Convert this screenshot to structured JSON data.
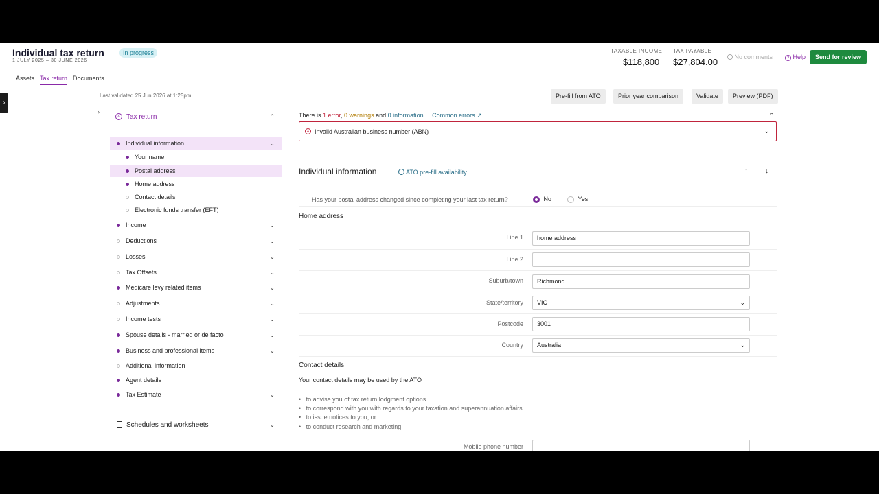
{
  "header": {
    "title": "Individual tax return",
    "status_badge": "In progress",
    "date_range": "1 JULY 2025 – 30 JUNE 2026",
    "taxable_income_label": "TAXABLE INCOME",
    "taxable_income_value": "$118,800",
    "tax_payable_label": "TAX PAYABLE",
    "tax_payable_value": "$27,804.00",
    "comments": "No comments",
    "help": "Help",
    "send_button": "Send for review"
  },
  "tabs": [
    "Assets",
    "Tax return",
    "Documents"
  ],
  "toolbar": {
    "last_validated": "Last validated 25 Jun 2026 at 1:25pm",
    "buttons": [
      "Pre-fill from ATO",
      "Prior year comparison",
      "Validate",
      "Preview (PDF)"
    ]
  },
  "sidebar": {
    "heading": "Tax return",
    "section": "Individual information",
    "subitems": [
      "Your name",
      "Postal address",
      "Home address",
      "Contact details",
      "Electronic funds transfer (EFT)"
    ],
    "items": [
      "Income",
      "Deductions",
      "Losses",
      "Tax Offsets",
      "Medicare levy related items",
      "Adjustments",
      "Income tests",
      "Spouse details - married or de facto",
      "Business and professional items",
      "Additional information",
      "Agent details",
      "Tax Estimate"
    ],
    "schedules": "Schedules and worksheets"
  },
  "errors": {
    "prefix": "There is ",
    "error_count": "1 error",
    "sep1": ", ",
    "warnings": "0 warnings",
    "sep2": " and ",
    "info": "0 information",
    "common_errors": "Common errors",
    "message": "Invalid Australian business number (ABN)"
  },
  "section": {
    "title": "Individual information",
    "prefill": "ATO pre-fill availability",
    "question": "Has your postal address changed since completing your last tax return?",
    "no": "No",
    "yes": "Yes",
    "home_address": "Home address",
    "labels": {
      "line1": "Line 1",
      "line2": "Line 2",
      "suburb": "Suburb/town",
      "state": "State/territory",
      "postcode": "Postcode",
      "country": "Country"
    },
    "values": {
      "line1": "home address",
      "line2": "",
      "suburb": "Richmond",
      "state": "VIC",
      "postcode": "3001",
      "country": "Australia"
    },
    "contact_heading": "Contact details",
    "contact_intro": "Your contact details may be used by the ATO",
    "bullets": [
      "to advise you of tax return lodgment options",
      "to correspond with you with regards to your taxation and superannuation affairs",
      "to issue notices to you, or",
      "to conduct research and marketing."
    ],
    "mobile_label": "Mobile phone number"
  },
  "colors": {
    "accent": "#8a2aa8",
    "primary_button": "#1e8a3e",
    "error": "#c0243c"
  }
}
